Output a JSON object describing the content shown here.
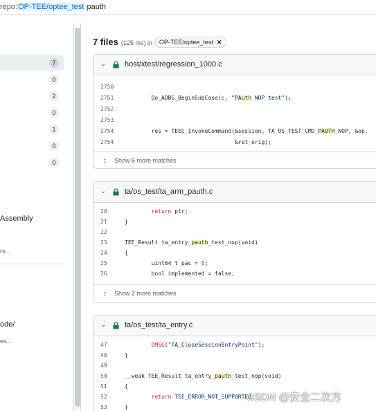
{
  "search": {
    "query_prefix": "repo:",
    "repo": "OP-TEE/optee_test",
    "term": " pauth"
  },
  "sidebar": {
    "facet_counts": [
      "7",
      "0",
      "2",
      "0",
      "1",
      "0",
      "0"
    ],
    "lang_fragment": "Assembly",
    "more_1": "rs...",
    "path_fragment": "ode/",
    "more_2": "es..."
  },
  "results": {
    "count": "7 files",
    "meta": "(125 ms) in",
    "filter_chip": "OP-TEE/optee_test",
    "chip_close": "✕"
  },
  "cards": [
    {
      "path": "host/xtest/regression_1000.c",
      "lines": [
        {
          "ln": "2750",
          "segs": []
        },
        {
          "ln": "2751",
          "segs": [
            {
              "t": "        Do_ADBG_BeginSubCase(c, ",
              "c": ""
            },
            {
              "t": "\"",
              "c": "str"
            },
            {
              "t": "PAuth",
              "c": "str mark"
            },
            {
              "t": " NOP test\"",
              "c": "str"
            },
            {
              "t": ");",
              "c": ""
            }
          ]
        },
        {
          "ln": "2752",
          "segs": []
        },
        {
          "ln": "2753",
          "segs": []
        },
        {
          "ln": "2754",
          "segs": [
            {
              "t": "        res = TEEC_InvokeCommand(&session, TA_OS_TEST_CMD_",
              "c": ""
            },
            {
              "t": "PAUTH",
              "c": "mark"
            },
            {
              "t": "_NOP, &op,",
              "c": ""
            }
          ]
        },
        {
          "ln": "2754",
          "segs": [
            {
              "t": "                                 &ret_orig);",
              "c": ""
            }
          ]
        }
      ],
      "footer": "Show 6 more matches"
    },
    {
      "path": "ta/os_test/ta_arm_pauth.c",
      "lines": [
        {
          "ln": "20",
          "segs": [
            {
              "t": "        ",
              "c": ""
            },
            {
              "t": "return",
              "c": "kw"
            },
            {
              "t": " ptr;",
              "c": ""
            }
          ]
        },
        {
          "ln": "21",
          "segs": [
            {
              "t": "}",
              "c": ""
            }
          ]
        },
        {
          "ln": "22",
          "segs": []
        },
        {
          "ln": "23",
          "segs": [
            {
              "t": "TEE_Result ta_entry_",
              "c": ""
            },
            {
              "t": "pauth",
              "c": "mark"
            },
            {
              "t": "_test_nop(void)",
              "c": ""
            }
          ]
        },
        {
          "ln": "24",
          "segs": [
            {
              "t": "{",
              "c": ""
            }
          ]
        },
        {
          "ln": "25",
          "segs": [
            {
              "t": "        uint64_t pac = ",
              "c": ""
            },
            {
              "t": "0",
              "c": "kw"
            },
            {
              "t": ";",
              "c": ""
            }
          ]
        },
        {
          "ln": "26",
          "segs": [
            {
              "t": "        bool implemented = false;",
              "c": ""
            }
          ]
        }
      ],
      "footer": "Show 2 more matches"
    },
    {
      "path": "ta/os_test/ta_entry.c",
      "lines": [
        {
          "ln": "47",
          "segs": [
            {
              "t": "        ",
              "c": ""
            },
            {
              "t": "DMSG",
              "c": "kw"
            },
            {
              "t": "(",
              "c": ""
            },
            {
              "t": "\"TA_CloseSessionEntryPoint\"",
              "c": "str"
            },
            {
              "t": ");",
              "c": ""
            }
          ]
        },
        {
          "ln": "48",
          "segs": [
            {
              "t": "}",
              "c": ""
            }
          ]
        },
        {
          "ln": "49",
          "segs": []
        },
        {
          "ln": "50",
          "segs": [
            {
              "t": "__weak TEE_Result ta_entry_",
              "c": ""
            },
            {
              "t": "pauth",
              "c": "mark"
            },
            {
              "t": "_test_nop(void)",
              "c": ""
            }
          ]
        },
        {
          "ln": "51",
          "segs": [
            {
              "t": "{",
              "c": ""
            }
          ]
        },
        {
          "ln": "52",
          "segs": [
            {
              "t": "        ",
              "c": ""
            },
            {
              "t": "return",
              "c": "kw"
            },
            {
              "t": " TEE_ERROR_NOT_SUPPORTED;",
              "c": "str"
            }
          ]
        },
        {
          "ln": "53",
          "segs": [
            {
              "t": "}",
              "c": ""
            }
          ]
        }
      ],
      "footer": ""
    }
  ],
  "watermark": "CSDN @安全二次方",
  "colors": {
    "accent": "#0969da",
    "highlight": "#fff8c5",
    "keyword": "#cf222e",
    "string": "#0a3069",
    "border": "#d0d7de"
  }
}
